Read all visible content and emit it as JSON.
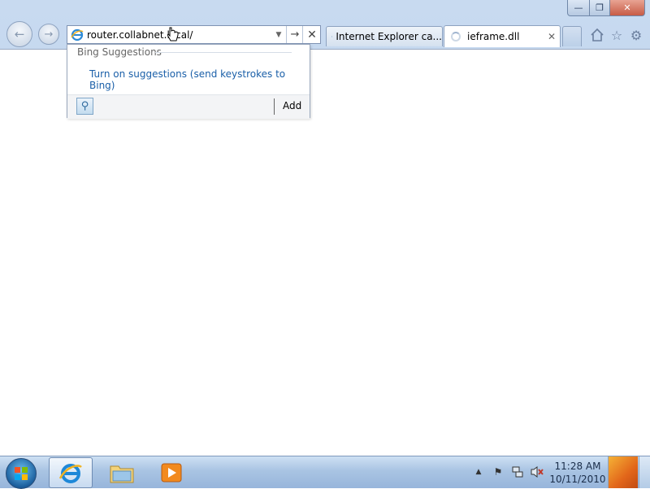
{
  "browser": {
    "address": {
      "value": "router.collabnet.local/",
      "go_symbol": "→",
      "stop_symbol": "✕",
      "dropdown_symbol": "▼"
    },
    "tabs": [
      {
        "label": "Internet Explorer ca...",
        "icon": "ie-page-icon"
      },
      {
        "label": "ieframe.dll",
        "icon": "loading-spinner-icon",
        "close_symbol": "✕"
      }
    ],
    "caption": {
      "minimize": "—",
      "maximize": "❐",
      "close": "✕"
    },
    "toolbar_icons": [
      "home-icon",
      "favorites-icon",
      "tools-icon"
    ]
  },
  "suggestions": {
    "header": "Bing Suggestions",
    "link": "Turn on suggestions (send keystrokes to Bing)",
    "add_label": "Add"
  },
  "taskbar": {
    "time": "11:28 AM",
    "date": "10/11/2010",
    "pinned": [
      "internet-explorer",
      "windows-explorer",
      "windows-media-player"
    ]
  },
  "colors": {
    "link": "#1a5fa8",
    "frame": "#b7cde9",
    "taskbar": "#a9c4e3"
  }
}
